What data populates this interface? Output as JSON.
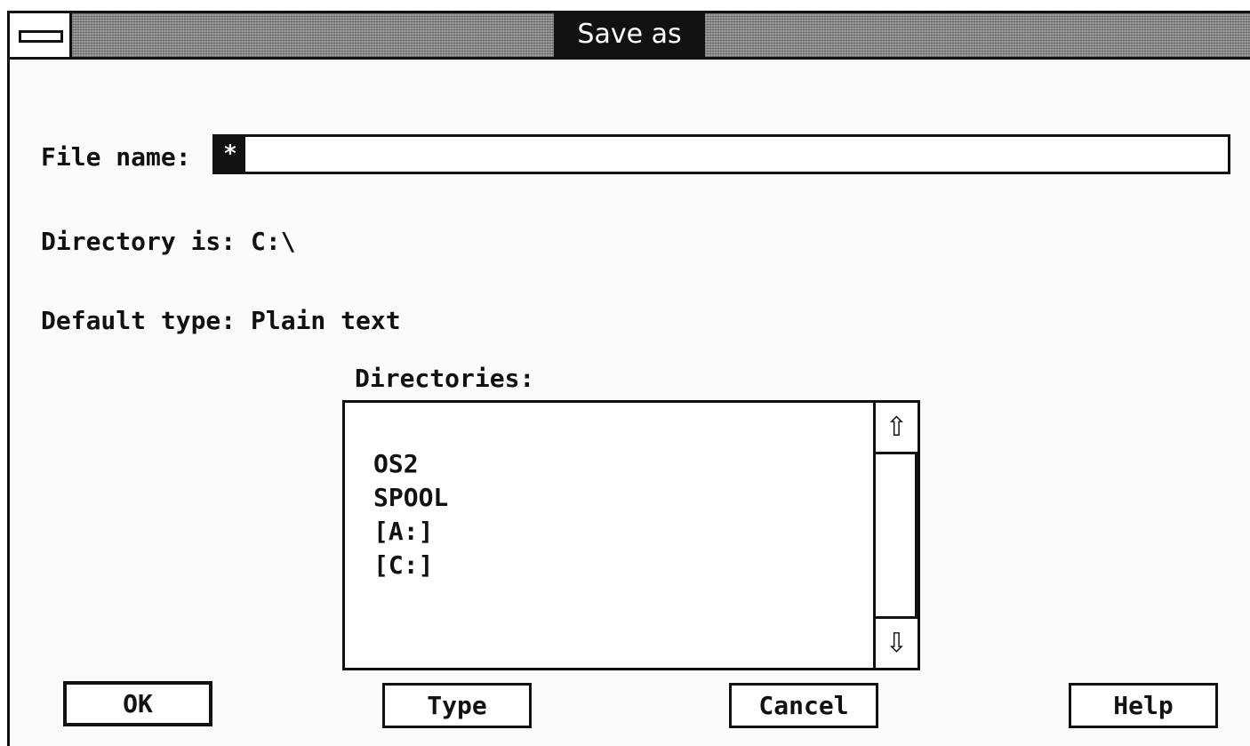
{
  "window": {
    "title": "Save as"
  },
  "form": {
    "filename_label": "File name:",
    "filename_value": "*",
    "directory_label": "Directory is: C:\\",
    "default_type_label": "Default type: Plain text",
    "directories_label": "Directories:"
  },
  "directories": {
    "items": [
      "OS2",
      "SPOOL",
      "[A:]",
      "[C:]"
    ]
  },
  "scrollbar": {
    "up_icon": "arrow-up-icon",
    "down_icon": "arrow-down-icon",
    "up_glyph": "⇧",
    "down_glyph": "⇩"
  },
  "buttons": {
    "ok": "OK",
    "type": "Type",
    "cancel": "Cancel",
    "help": "Help"
  },
  "colors": {
    "titlebar": "#8a8a8a",
    "title_bg": "#111111",
    "title_fg": "#ffffff"
  }
}
